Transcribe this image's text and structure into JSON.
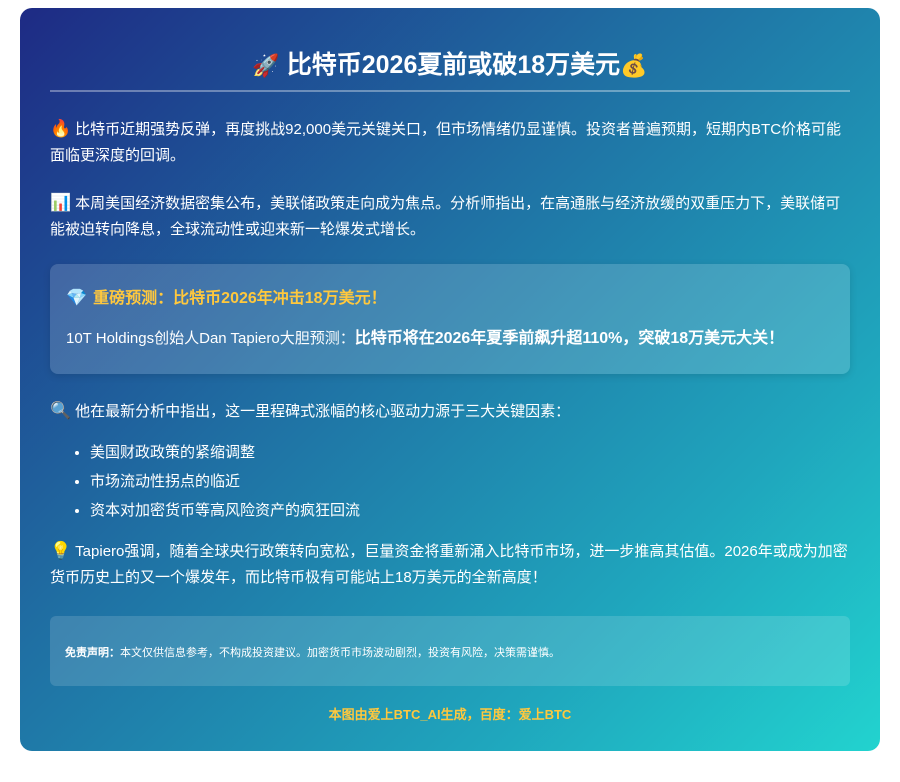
{
  "title": {
    "icon": "rocket-icon",
    "text": "比特币2026夏前或破18万美元",
    "trailing_icon": "money-bag-icon"
  },
  "paragraph1": {
    "icon": "fire-icon",
    "text": "比特币近期强势反弹，再度挑战92,000美元关键关口，但市场情绪仍显谨慎。投资者普遍预期，短期内BTC价格可能面临更深度的回调。"
  },
  "paragraph2": {
    "icon": "chart-icon",
    "text": "本周美国经济数据密集公布，美联储政策走向成为焦点。分析师指出，在高通胀与经济放缓的双重压力下，美联储可能被迫转向降息，全球流动性或迎来新一轮爆发式增长。"
  },
  "highlight": {
    "icon": "gem-icon",
    "title": "重磅预测：比特币2026年冲击18万美元！",
    "body_prefix": "10T Holdings创始人Dan Tapiero大胆预测：",
    "body_bold": "比特币将在2026年夏季前飙升超110%，突破18万美元大关！"
  },
  "paragraph3": {
    "icon": "magnifier-icon",
    "text": "他在最新分析中指出，这一里程碑式涨幅的核心驱动力源于三大关键因素："
  },
  "factors": [
    "美国财政政策的紧缩调整",
    "市场流动性拐点的临近",
    "资本对加密货币等高风险资产的疯狂回流"
  ],
  "paragraph4": {
    "icon": "lightbulb-icon",
    "text": "Tapiero强调，随着全球央行政策转向宽松，巨量资金将重新涌入比特币市场，进一步推高其估值。2026年或成为加密货币历史上的又一个爆发年，而比特币极有可能站上18万美元的全新高度！"
  },
  "disclaimer": {
    "label": "免责声明：",
    "text": "本文仅供信息参考，不构成投资建议。加密货币市场波动剧烈，投资有风险，决策需谨慎。"
  },
  "footer": "本图由爱上BTC_AI生成，百度：爱上BTC",
  "colors": {
    "gradient_start": "#1e2a84",
    "gradient_end": "#22d3cf",
    "accent": "#ffc83d"
  }
}
